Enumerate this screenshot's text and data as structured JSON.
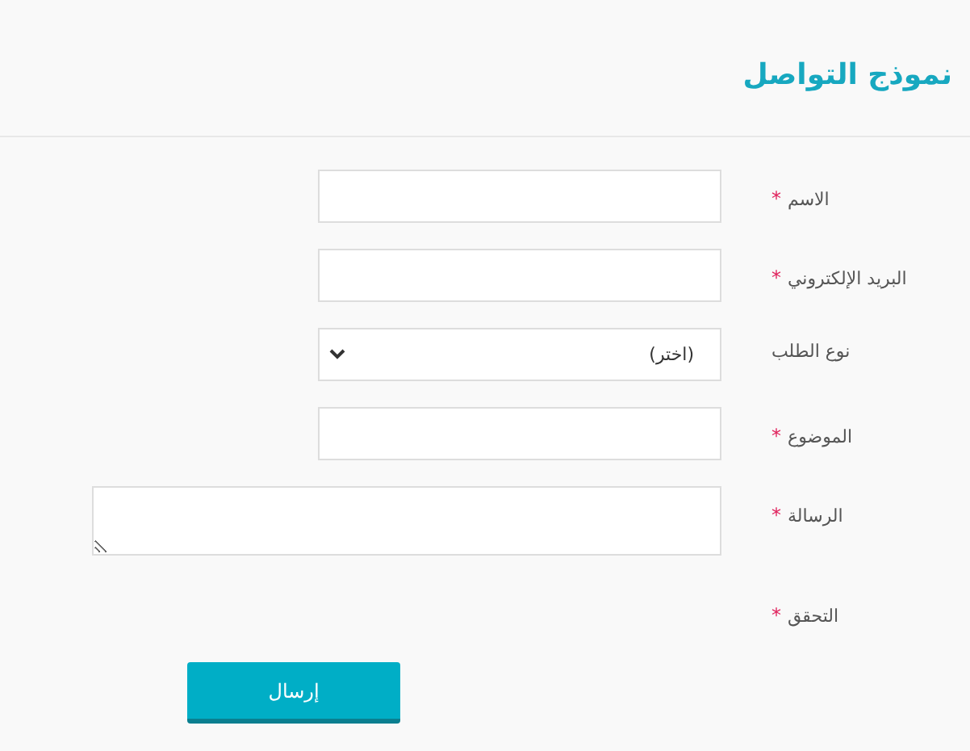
{
  "title": "نموذج التواصل",
  "required_marker": "*",
  "fields": [
    {
      "label": "الاسم",
      "required": true,
      "kind": "text"
    },
    {
      "label": "البريد الإلكتروني",
      "required": true,
      "kind": "text"
    },
    {
      "label": "نوع الطلب",
      "required": false,
      "kind": "select",
      "value": "(اختر)"
    },
    {
      "label": "الموضوع",
      "required": true,
      "kind": "text"
    },
    {
      "label": "الرسالة",
      "required": true,
      "kind": "textarea"
    },
    {
      "label": "التحقق",
      "required": true,
      "kind": "captcha"
    }
  ],
  "submit_button": "إرسال"
}
